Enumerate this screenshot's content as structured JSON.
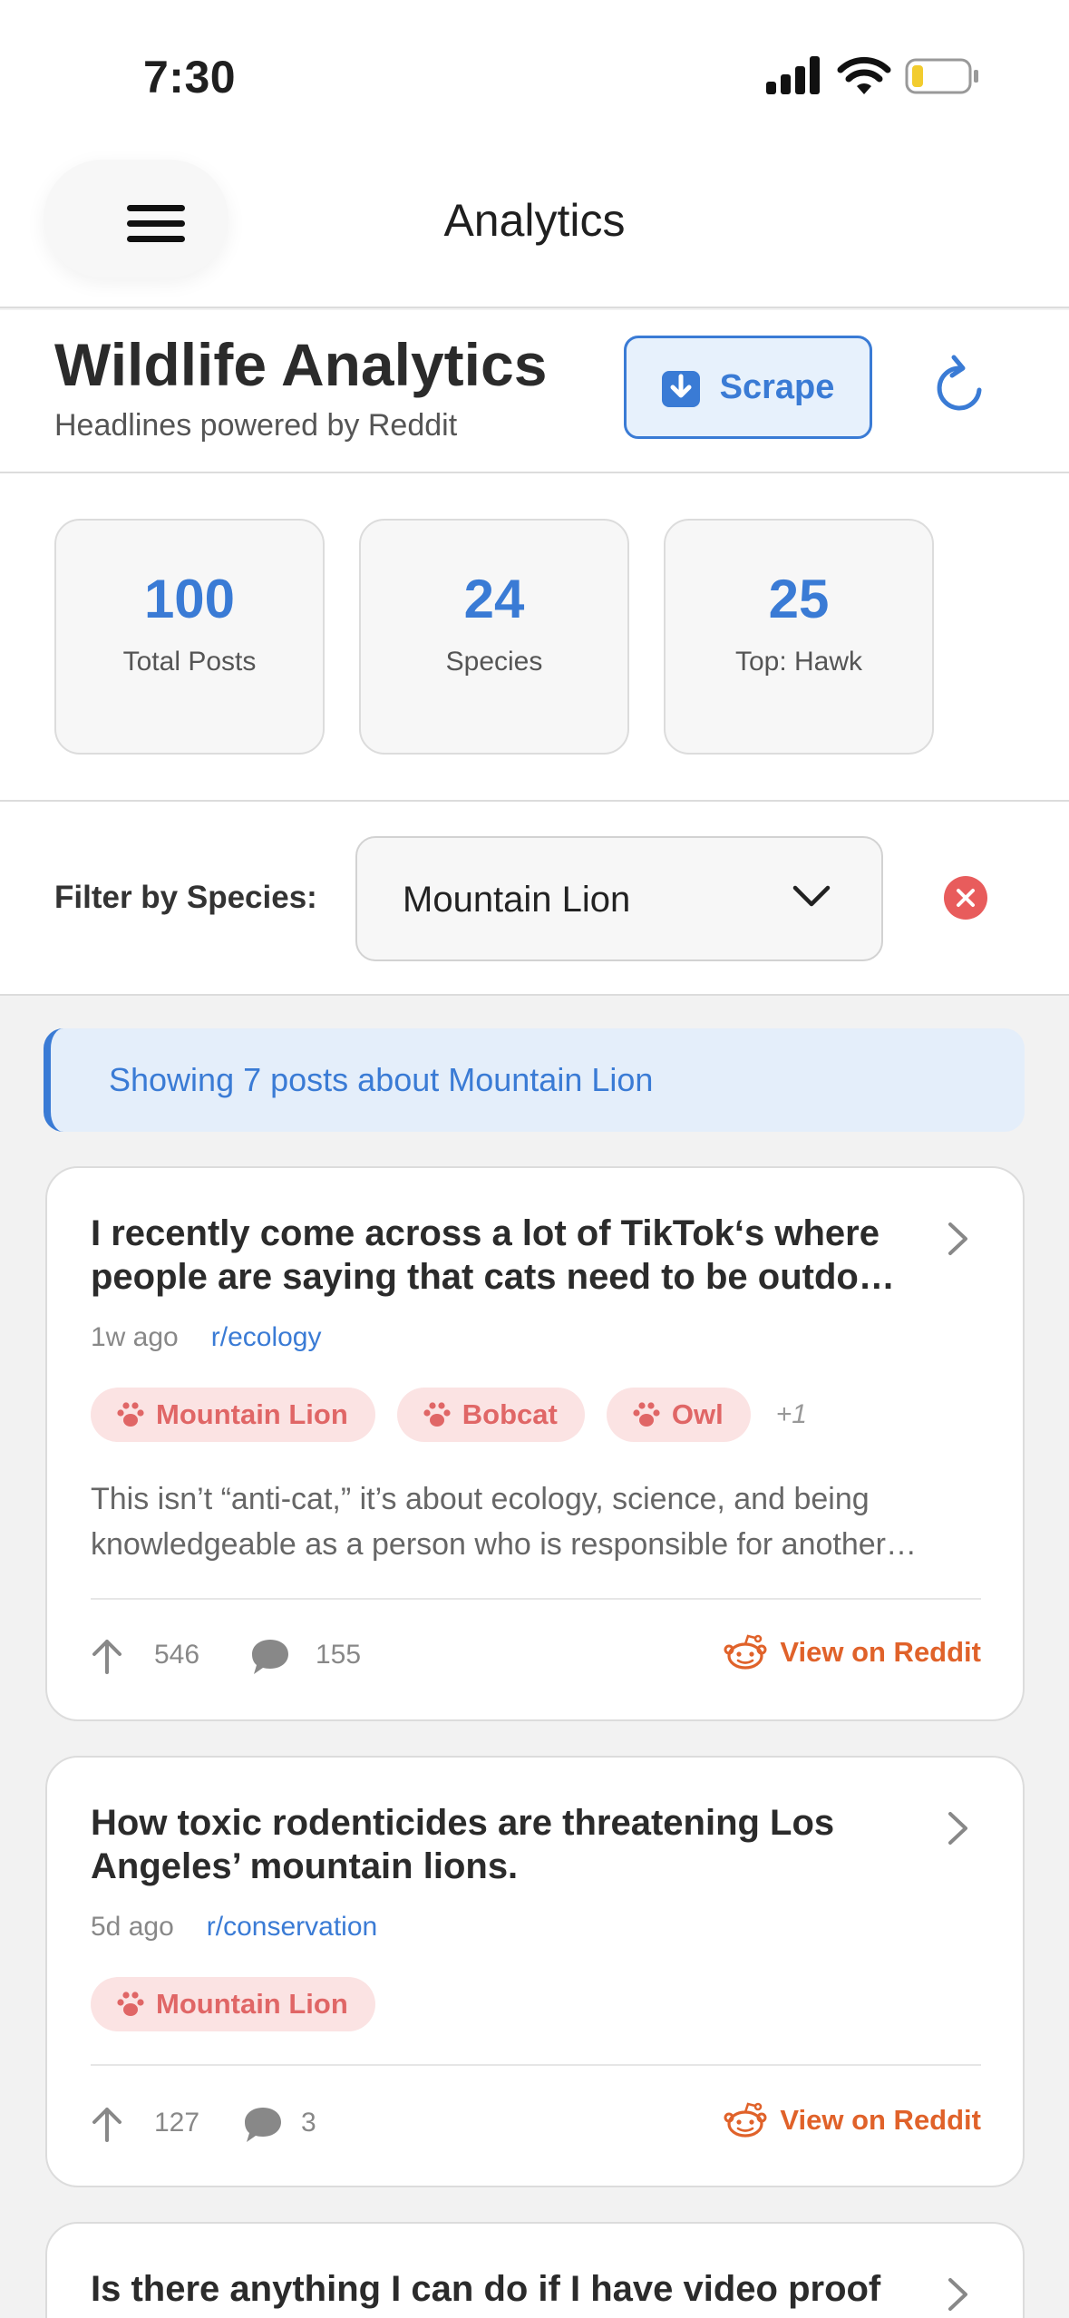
{
  "status_bar": {
    "time": "7:30"
  },
  "nav": {
    "title": "Analytics"
  },
  "header": {
    "title": "Wildlife Analytics",
    "subtitle": "Headlines powered by Reddit",
    "scrape_label": "Scrape"
  },
  "stats": [
    {
      "value": "100",
      "label": "Total Posts"
    },
    {
      "value": "24",
      "label": "Species"
    },
    {
      "value": "25",
      "label": "Top: Hawk"
    }
  ],
  "filter": {
    "label": "Filter by Species:",
    "selected": "Mountain Lion"
  },
  "banner": {
    "text": "Showing 7 posts about Mountain Lion"
  },
  "posts": [
    {
      "title": "I recently come across a lot of TikTok‘s where people are saying that cats need to be outdo…",
      "age": "1w ago",
      "subreddit": "r/ecology",
      "tags": [
        "Mountain Lion",
        "Bobcat",
        "Owl"
      ],
      "more_tags": "+1",
      "excerpt": "This isn’t “anti-cat,” it’s about ecology, science, and being knowledgeable as a person who is responsible for another…",
      "upvotes": "546",
      "comments": "155",
      "view_label": "View on Reddit"
    },
    {
      "title": "How toxic rodenticides are threatening Los Angeles’ mountain lions.",
      "age": "5d ago",
      "subreddit": "r/conservation",
      "tags": [
        "Mountain Lion"
      ],
      "upvotes": "127",
      "comments": "3",
      "view_label": "View on Reddit"
    },
    {
      "title": "Is there anything I can do if I have video proof"
    }
  ],
  "colors": {
    "accent": "#3a7bd5",
    "tag_bg": "#fbe3e3",
    "tag_text": "#e06666",
    "reddit": "#e0622a",
    "clear": "#e85c5c"
  }
}
